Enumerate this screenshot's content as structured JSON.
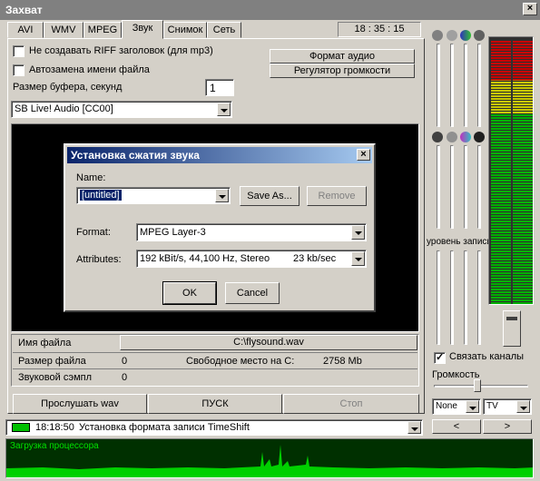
{
  "window": {
    "title": "Захват"
  },
  "tabs": [
    {
      "label": "AVI"
    },
    {
      "label": "WMV"
    },
    {
      "label": "MPEG"
    },
    {
      "label": "Звук"
    },
    {
      "label": "Снимок"
    },
    {
      "label": "Сеть"
    }
  ],
  "active_tab": "Звук",
  "clock": "18 : 35 : 15",
  "options": {
    "no_riff": "Не создавать RIFF заголовок (для mp3)",
    "auto_rename": "Автозамена имени файла",
    "buffer_label": "Размер буфера, секунд",
    "buffer_value": "1",
    "device": "SB Live! Audio [CC00]"
  },
  "buttons": {
    "audio_format": "Формат аудио",
    "volume_control": "Регулятор громкости"
  },
  "dialog": {
    "title": "Установка сжатия звука",
    "name_label": "Name:",
    "name_value": "[untitled]",
    "save_as": "Save As...",
    "remove": "Remove",
    "format_label": "Format:",
    "format_value": "MPEG Layer-3",
    "attributes_label": "Attributes:",
    "attributes_value": "192 kBit/s, 44,100 Hz, Stereo",
    "attributes_rate": "23 kb/sec",
    "ok": "OK",
    "cancel": "Cancel"
  },
  "file_info": {
    "file_name_label": "Имя файла",
    "file_name_value": "C:\\flysound.wav",
    "file_size_label": "Размер файла",
    "file_size_value": "0",
    "free_space_label": "Свободное место на С:",
    "free_space_value": "2758 Mb",
    "sample_label": "Звуковой сэмпл",
    "sample_value": "0"
  },
  "actions": {
    "listen": "Прослушать wav",
    "start": "ПУСК",
    "stop": "Стоп"
  },
  "status": {
    "time": "18:18:50",
    "message": "Установка формата записи TimeShift"
  },
  "cpu": {
    "label": "Загрузка процессора"
  },
  "mixer": {
    "record_level_label": "уровень записи",
    "link_channels": "Связать каналы",
    "volume_label": "Громкость",
    "select_left": "None",
    "select_right": "TV",
    "prev": "<",
    "next": ">"
  },
  "colors": {
    "meter_green": "#00b000",
    "meter_yellow": "#c8c800",
    "meter_red": "#c80000",
    "cpu_bg": "#003000",
    "cpu_graph": "#00e000"
  }
}
